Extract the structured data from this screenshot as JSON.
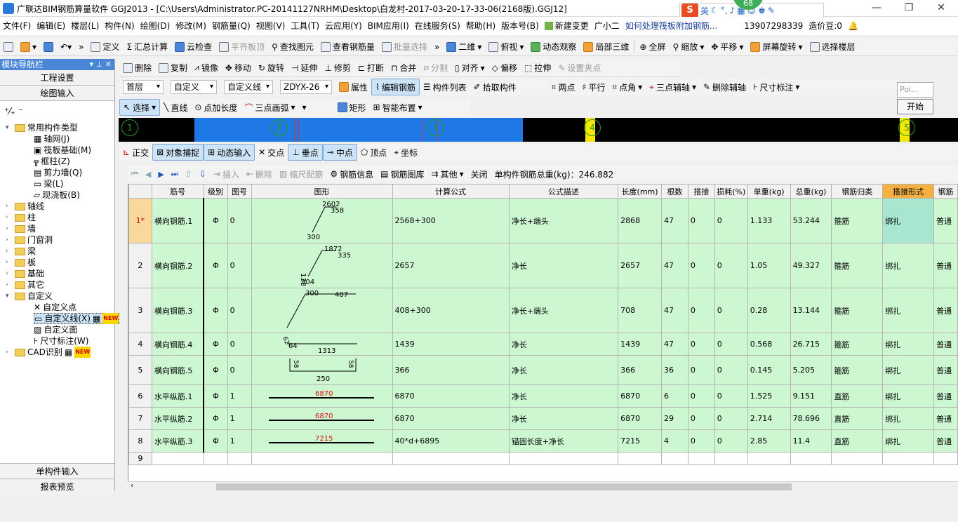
{
  "window": {
    "title": "广联达BIM钢筋算量软件 GGJ2013 - [C:\\Users\\Administrator.PC-20141127NRHM\\Desktop\\白龙村-2017-03-20-17-33-06(2168版).GGJ12]",
    "ime": {
      "logo": "S",
      "lang": "英",
      "badge": "68"
    }
  },
  "menu": [
    "文件(F)",
    "编辑(E)",
    "楼层(L)",
    "构件(N)",
    "绘图(D)",
    "修改(M)",
    "钢筋量(Q)",
    "视图(V)",
    "工具(T)",
    "云应用(Y)",
    "BIM应用(I)",
    "在线服务(S)",
    "帮助(H)",
    "版本号(B)",
    "新建变更",
    "广小二",
    "如何处理筏板附加钢筋...",
    "13907298339",
    "造价豆:0"
  ],
  "toolbar1": [
    "定义",
    "汇总计算",
    "云检查",
    "平齐板顶",
    "查找图元",
    "查看钢筋量",
    "批量选择",
    "二维",
    "俯视",
    "动态观察",
    "局部三维",
    "全屏",
    "缩放",
    "平移",
    "屏幕旋转",
    "选择楼层"
  ],
  "toolbar2": [
    "删除",
    "复制",
    "镜像",
    "移动",
    "旋转",
    "延伸",
    "修剪",
    "打断",
    "合并",
    "分割",
    "对齐",
    "偏移",
    "拉伸",
    "设置夹点"
  ],
  "toolbar3": {
    "floor": "首层",
    "category": "自定义",
    "type": "自定义线",
    "name": "ZDYX-26",
    "items": [
      "属性",
      "编辑钢筋",
      "构件列表",
      "拾取构件"
    ],
    "axis_items": [
      "两点",
      "平行",
      "点角",
      "三点辅轴",
      "删除辅轴",
      "尺寸标注"
    ]
  },
  "toolbar4": [
    "选择",
    "直线",
    "点加长度",
    "三点画弧",
    "矩形",
    "智能布置"
  ],
  "snapbar": [
    "正交",
    "对象捕捉",
    "动态输入",
    "交点",
    "垂点",
    "中点",
    "顶点",
    "坐标"
  ],
  "floatbox": {
    "input_placeholder": "Poi...",
    "button": "开始"
  },
  "panel": {
    "title": "模块导航栏",
    "btn_project": "工程设置",
    "btn_draw": "绘图输入",
    "btn_single": "单构件输入",
    "btn_report": "报表预览",
    "tree": {
      "root": "常用构件类型",
      "common": [
        "轴网(J)",
        "筏板基础(M)",
        "框柱(Z)",
        "剪力墙(Q)",
        "梁(L)",
        "现浇板(B)"
      ],
      "groups": [
        "轴线",
        "柱",
        "墙",
        "门窗洞",
        "梁",
        "板",
        "基础",
        "其它"
      ],
      "custom": "自定义",
      "custom_items": [
        "自定义点",
        "自定义线(X)",
        "自定义面",
        "尺寸标注(W)"
      ],
      "cad": "CAD识别",
      "new": "NEW"
    }
  },
  "canvas": {
    "axes": [
      "1",
      "2",
      "3",
      "4",
      "5"
    ]
  },
  "rebarbar": {
    "items": [
      "插入",
      "删除",
      "缩尺配筋",
      "钢筋信息",
      "钢筋图库",
      "其他",
      "关闭"
    ],
    "total_label": "单构件钢筋总重(kg)：246.882"
  },
  "grid": {
    "columns": [
      "筋号",
      "级别",
      "图号",
      "图形",
      "计算公式",
      "公式描述",
      "长度(mm)",
      "根数",
      "搭接",
      "损耗(%)",
      "单重(kg)",
      "总重(kg)",
      "钢筋归类",
      "搭接形式",
      "钢筋"
    ],
    "rows": [
      {
        "no": "1*",
        "name": "横向钢筋.1",
        "grade": "Φ",
        "fig": "0",
        "formula": "2568+300",
        "desc": "净长+端头",
        "len": "2868",
        "count": "47",
        "lap": "0",
        "loss": "0",
        "unit": "1.133",
        "total": "53.244",
        "cls": "箍筋",
        "lapform": "绑扎",
        "extra": "普通",
        "shape": [
          "2602",
          "358",
          "300"
        ]
      },
      {
        "no": "2",
        "name": "横向钢筋.2",
        "grade": "Φ",
        "fig": "0",
        "formula": "2657",
        "desc": "净长",
        "len": "2657",
        "count": "47",
        "lap": "0",
        "loss": "0",
        "unit": "1.05",
        "total": "49.327",
        "cls": "箍筋",
        "lapform": "绑扎",
        "extra": "普通",
        "shape": [
          "1872",
          "335",
          "138",
          "304"
        ]
      },
      {
        "no": "3",
        "name": "横向钢筋.3",
        "grade": "Φ",
        "fig": "0",
        "formula": "408+300",
        "desc": "净长+端头",
        "len": "708",
        "count": "47",
        "lap": "0",
        "loss": "0",
        "unit": "0.28",
        "total": "13.144",
        "cls": "箍筋",
        "lapform": "绑扎",
        "extra": "普通",
        "shape": [
          "300",
          "407"
        ]
      },
      {
        "no": "4",
        "name": "横向钢筋.4",
        "grade": "Φ",
        "fig": "0",
        "formula": "1439",
        "desc": "净长",
        "len": "1439",
        "count": "47",
        "lap": "0",
        "loss": "0",
        "unit": "0.568",
        "total": "26.715",
        "cls": "箍筋",
        "lapform": "绑扎",
        "extra": "普通",
        "shape": [
          "62",
          "64",
          "1313"
        ]
      },
      {
        "no": "5",
        "name": "横向钢筋.5",
        "grade": "Φ",
        "fig": "0",
        "formula": "366",
        "desc": "净长",
        "len": "366",
        "count": "36",
        "lap": "0",
        "loss": "0",
        "unit": "0.145",
        "total": "5.205",
        "cls": "箍筋",
        "lapform": "绑扎",
        "extra": "普通",
        "shape": [
          "58",
          "58",
          "250"
        ]
      },
      {
        "no": "6",
        "name": "水平纵筋.1",
        "grade": "Φ",
        "fig": "1",
        "formula": "6870",
        "desc": "净长",
        "len": "6870",
        "count": "6",
        "lap": "0",
        "loss": "0",
        "unit": "1.525",
        "total": "9.151",
        "cls": "直筋",
        "lapform": "绑扎",
        "extra": "普通",
        "shape": [
          "6870"
        ]
      },
      {
        "no": "7",
        "name": "水平纵筋.2",
        "grade": "Φ",
        "fig": "1",
        "formula": "6870",
        "desc": "净长",
        "len": "6870",
        "count": "29",
        "lap": "0",
        "loss": "0",
        "unit": "2.714",
        "total": "78.696",
        "cls": "直筋",
        "lapform": "绑扎",
        "extra": "普通",
        "shape": [
          "6870"
        ]
      },
      {
        "no": "8",
        "name": "水平纵筋.3",
        "grade": "Φ",
        "fig": "1",
        "formula": "40*d+6895",
        "desc": "锚固长度+净长",
        "len": "7215",
        "count": "4",
        "lap": "0",
        "loss": "0",
        "unit": "2.85",
        "total": "11.4",
        "cls": "直筋",
        "lapform": "绑扎",
        "extra": "普通",
        "shape": [
          "7215"
        ]
      },
      {
        "no": "9",
        "name": "",
        "grade": "",
        "fig": "",
        "formula": "",
        "desc": "",
        "len": "",
        "count": "",
        "lap": "",
        "loss": "",
        "unit": "",
        "total": "",
        "cls": "",
        "lapform": "",
        "extra": "",
        "shape": []
      }
    ]
  }
}
